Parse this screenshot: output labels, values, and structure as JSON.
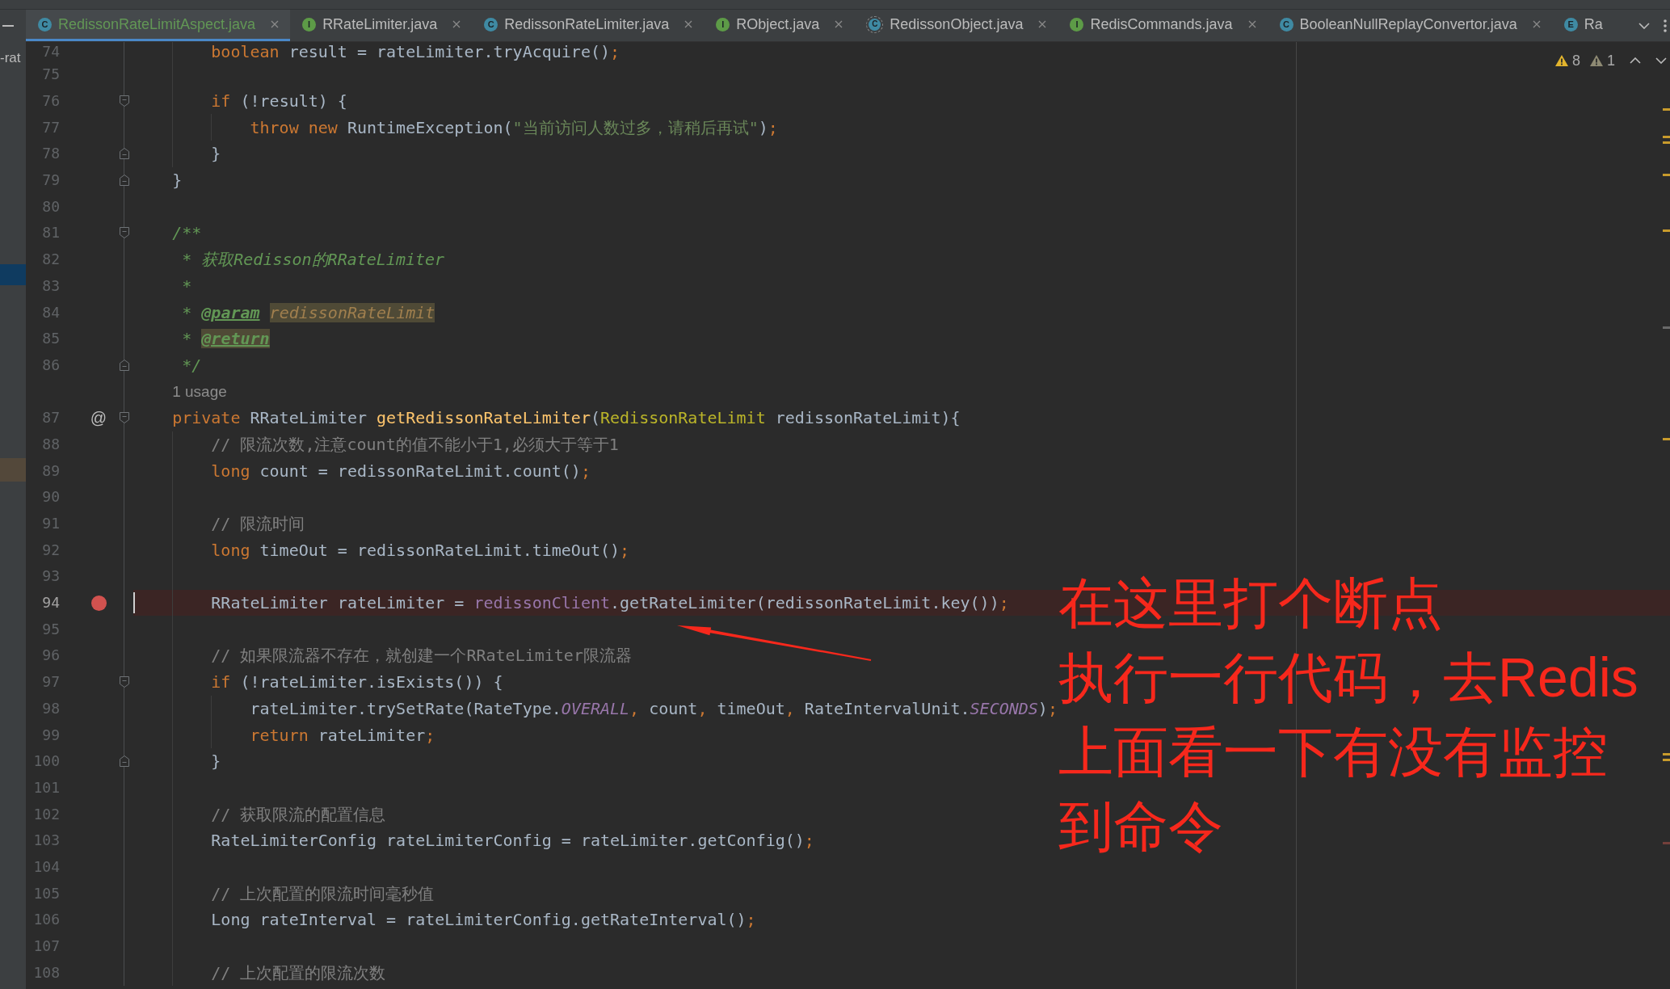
{
  "project_panel": {
    "text": "-rat",
    "highlights": [
      {
        "kind": "selection"
      },
      {
        "kind": "match"
      }
    ]
  },
  "tabs": [
    {
      "label": "RedissonRateLimitAspect.java",
      "icon_letter": "C",
      "kind": "class",
      "color": "#629755",
      "selected": true,
      "close_button": true
    },
    {
      "label": "RRateLimiter.java",
      "icon_letter": "I",
      "kind": "interface",
      "color": "#bbbbbb",
      "selected": false,
      "close_button": true
    },
    {
      "label": "RedissonRateLimiter.java",
      "icon_letter": "C",
      "kind": "class",
      "color": "#bbbbbb",
      "selected": false,
      "close_button": true
    },
    {
      "label": "RObject.java",
      "icon_letter": "I",
      "kind": "interface",
      "color": "#bbbbbb",
      "selected": false,
      "close_button": true
    },
    {
      "label": "RedissonObject.java",
      "icon_letter": "C",
      "kind": "abstract",
      "color": "#bbbbbb",
      "selected": false,
      "close_button": true
    },
    {
      "label": "RedisCommands.java",
      "icon_letter": "I",
      "kind": "interface",
      "color": "#bbbbbb",
      "selected": false,
      "close_button": true
    },
    {
      "label": "BooleanNullReplayConvertor.java",
      "icon_letter": "C",
      "kind": "class",
      "color": "#bbbbbb",
      "selected": false,
      "close_button": true
    },
    {
      "label": "Ra",
      "icon_letter": "E",
      "kind": "enum",
      "color": "#bbbbbb",
      "selected": false,
      "close_button": false
    }
  ],
  "inspections": [
    {
      "kind": "warning",
      "count": "8"
    },
    {
      "kind": "weak_warning",
      "count": "1"
    }
  ],
  "editor": {
    "lines": [
      {
        "kind": "block",
        "children": [
          {
            "kind": "code",
            "number": "74",
            "breakpoint": false,
            "current": false,
            "tokens": [
              {
                "kind": "keyword",
                "text": "boolean"
              },
              {
                "kind": "plain",
                "text": " result = rateLimiter.tryAcquire()"
              },
              {
                "kind": "punct",
                "text": ";"
              }
            ]
          },
          {
            "kind": "code",
            "number": "75",
            "breakpoint": false,
            "current": false
          },
          {
            "kind": "code",
            "number": "76",
            "fold": {
              "kind": "start"
            },
            "breakpoint": false,
            "current": false,
            "tokens": [
              {
                "kind": "keyword",
                "text": "if"
              },
              {
                "kind": "plain",
                "text": " (!result) {"
              }
            ],
            "children": [
              {
                "kind": "code",
                "number": "77",
                "breakpoint": false,
                "current": false,
                "tokens": [
                  {
                    "kind": "keyword",
                    "text": "throw new"
                  },
                  {
                    "kind": "plain",
                    "text": " RuntimeException("
                  },
                  {
                    "kind": "string",
                    "text": "\"当前访问人数过多，请稍后再试\""
                  },
                  {
                    "kind": "plain",
                    "text": ")"
                  },
                  {
                    "kind": "punct",
                    "text": ";"
                  }
                ]
              }
            ]
          },
          {
            "kind": "code",
            "number": "78",
            "fold": {
              "kind": "end"
            },
            "breakpoint": false,
            "current": false,
            "tokens": [
              {
                "kind": "plain",
                "text": "}"
              }
            ]
          }
        ]
      },
      {
        "kind": "code",
        "number": "79",
        "fold": {
          "kind": "end"
        },
        "breakpoint": false,
        "current": false,
        "tokens": [
          {
            "kind": "plain",
            "text": "}"
          }
        ]
      },
      {
        "kind": "code",
        "number": "80",
        "breakpoint": false,
        "current": false
      },
      {
        "kind": "code",
        "number": "81",
        "fold": {
          "kind": "start"
        },
        "breakpoint": false,
        "current": false,
        "tokens": [
          {
            "kind": "doc",
            "text": "/**"
          }
        ]
      },
      {
        "kind": "doc",
        "number": "82",
        "breakpoint": false,
        "current": false,
        "tokens": [
          {
            "kind": "doc",
            "text": "* 获取Redisson的RRateLimiter"
          }
        ]
      },
      {
        "kind": "doc",
        "number": "83",
        "breakpoint": false,
        "current": false,
        "tokens": [
          {
            "kind": "doc",
            "text": "*"
          }
        ]
      },
      {
        "kind": "doc",
        "number": "84",
        "breakpoint": false,
        "current": false,
        "tokens": [
          {
            "kind": "doc",
            "text": "* "
          },
          {
            "kind": "doc_tag",
            "text": "@param "
          },
          {
            "kind": "doc_param_warn",
            "text": "redissonRateLimit"
          }
        ]
      },
      {
        "kind": "doc",
        "number": "85",
        "breakpoint": false,
        "current": false,
        "tokens": [
          {
            "kind": "doc",
            "text": "* "
          },
          {
            "kind": "doc_tag_warn",
            "text": "@return"
          }
        ]
      },
      {
        "kind": "doc",
        "number": "86",
        "fold": {
          "kind": "end"
        },
        "breakpoint": false,
        "current": false,
        "tokens": [
          {
            "kind": "doc",
            "text": "*/"
          }
        ]
      },
      {
        "kind": "hint",
        "text": "1 usage",
        "breakpoint": false,
        "current": false
      },
      {
        "kind": "code",
        "number": "87",
        "gutter_symbol": "@",
        "fold": {
          "kind": "start"
        },
        "breakpoint": false,
        "current": false,
        "tokens": [
          {
            "kind": "keyword",
            "text": "private"
          },
          {
            "kind": "plain",
            "text": " RRateLimiter "
          },
          {
            "kind": "method",
            "text": "getRedissonRateLimiter"
          },
          {
            "kind": "plain",
            "text": "("
          },
          {
            "kind": "annotation",
            "text": "RedissonRateLimit"
          },
          {
            "kind": "plain",
            "text": " redissonRateLimit){"
          }
        ],
        "children": [
          {
            "kind": "code",
            "number": "88",
            "breakpoint": false,
            "current": false,
            "tokens": [
              {
                "kind": "comment",
                "text": "// 限流次数,注意count的值不能小于1,必须大于等于1"
              }
            ]
          },
          {
            "kind": "code",
            "number": "89",
            "breakpoint": false,
            "current": false,
            "tokens": [
              {
                "kind": "keyword",
                "text": "long"
              },
              {
                "kind": "plain",
                "text": " count = redissonRateLimit.count()"
              },
              {
                "kind": "punct",
                "text": ";"
              }
            ]
          },
          {
            "kind": "code",
            "number": "90",
            "breakpoint": false,
            "current": false
          },
          {
            "kind": "code",
            "number": "91",
            "breakpoint": false,
            "current": false,
            "tokens": [
              {
                "kind": "comment",
                "text": "// 限流时间"
              }
            ]
          },
          {
            "kind": "code",
            "number": "92",
            "breakpoint": false,
            "current": false,
            "tokens": [
              {
                "kind": "keyword",
                "text": "long"
              },
              {
                "kind": "plain",
                "text": " timeOut = redissonRateLimit.timeOut()"
              },
              {
                "kind": "punct",
                "text": ";"
              }
            ]
          },
          {
            "kind": "code",
            "number": "93",
            "breakpoint": false,
            "current": false
          },
          {
            "kind": "code",
            "number": "94",
            "breakpoint": true,
            "current": true,
            "tokens": [
              {
                "kind": "plain",
                "text": "RRateLimiter rateLimiter = "
              },
              {
                "kind": "field",
                "text": "redissonClient"
              },
              {
                "kind": "plain",
                "text": ".getRateLimiter(redissonRateLimit.key())"
              },
              {
                "kind": "punct",
                "text": ";"
              }
            ]
          },
          {
            "kind": "code",
            "number": "95",
            "breakpoint": false,
            "current": false
          },
          {
            "kind": "code",
            "number": "96",
            "breakpoint": false,
            "current": false,
            "tokens": [
              {
                "kind": "comment",
                "text": "// 如果限流器不存在，就创建一个RRateLimiter限流器"
              }
            ]
          },
          {
            "kind": "code",
            "number": "97",
            "fold": {
              "kind": "start"
            },
            "breakpoint": false,
            "current": false,
            "tokens": [
              {
                "kind": "keyword",
                "text": "if"
              },
              {
                "kind": "plain",
                "text": " (!rateLimiter.isExists()) {"
              }
            ],
            "children": [
              {
                "kind": "code",
                "number": "98",
                "breakpoint": false,
                "current": false,
                "tokens": [
                  {
                    "kind": "plain",
                    "text": "rateLimiter.trySetRate(RateType."
                  },
                  {
                    "kind": "constant",
                    "text": "OVERALL"
                  },
                  {
                    "kind": "punct",
                    "text": ","
                  },
                  {
                    "kind": "plain",
                    "text": " count"
                  },
                  {
                    "kind": "punct",
                    "text": ","
                  },
                  {
                    "kind": "plain",
                    "text": " timeOut"
                  },
                  {
                    "kind": "punct",
                    "text": ","
                  },
                  {
                    "kind": "plain",
                    "text": " RateIntervalUnit."
                  },
                  {
                    "kind": "constant",
                    "text": "SECONDS"
                  },
                  {
                    "kind": "plain",
                    "text": ")"
                  },
                  {
                    "kind": "punct",
                    "text": ";"
                  }
                ]
              },
              {
                "kind": "code",
                "number": "99",
                "breakpoint": false,
                "current": false,
                "tokens": [
                  {
                    "kind": "keyword",
                    "text": "return"
                  },
                  {
                    "kind": "plain",
                    "text": " rateLimiter"
                  },
                  {
                    "kind": "punct",
                    "text": ";"
                  }
                ]
              }
            ]
          },
          {
            "kind": "code",
            "number": "100",
            "fold": {
              "kind": "end"
            },
            "breakpoint": false,
            "current": false,
            "tokens": [
              {
                "kind": "plain",
                "text": "}"
              }
            ]
          },
          {
            "kind": "code",
            "number": "101",
            "breakpoint": false,
            "current": false
          },
          {
            "kind": "code",
            "number": "102",
            "breakpoint": false,
            "current": false,
            "tokens": [
              {
                "kind": "comment",
                "text": "// 获取限流的配置信息"
              }
            ]
          },
          {
            "kind": "code",
            "number": "103",
            "breakpoint": false,
            "current": false,
            "tokens": [
              {
                "kind": "plain",
                "text": "RateLimiterConfig rateLimiterConfig = rateLimiter.getConfig()"
              },
              {
                "kind": "punct",
                "text": ";"
              }
            ]
          },
          {
            "kind": "code",
            "number": "104",
            "breakpoint": false,
            "current": false
          },
          {
            "kind": "code",
            "number": "105",
            "breakpoint": false,
            "current": false,
            "tokens": [
              {
                "kind": "comment",
                "text": "// 上次配置的限流时间毫秒值"
              }
            ]
          },
          {
            "kind": "code",
            "number": "106",
            "breakpoint": false,
            "current": false,
            "tokens": [
              {
                "kind": "plain",
                "text": "Long rateInterval = rateLimiterConfig.getRateInterval()"
              },
              {
                "kind": "punct",
                "text": ";"
              }
            ]
          },
          {
            "kind": "code",
            "number": "107",
            "breakpoint": false,
            "current": false
          },
          {
            "kind": "code",
            "number": "108",
            "breakpoint": false,
            "current": false,
            "tokens": [
              {
                "kind": "comment",
                "text": "// 上次配置的限流次数"
              }
            ]
          }
        ]
      }
    ]
  },
  "annotation": {
    "lines": [
      "在这里打个断点",
      "执行一行代码，去Redis",
      "上面看一下有没有监控",
      "到命令"
    ]
  }
}
